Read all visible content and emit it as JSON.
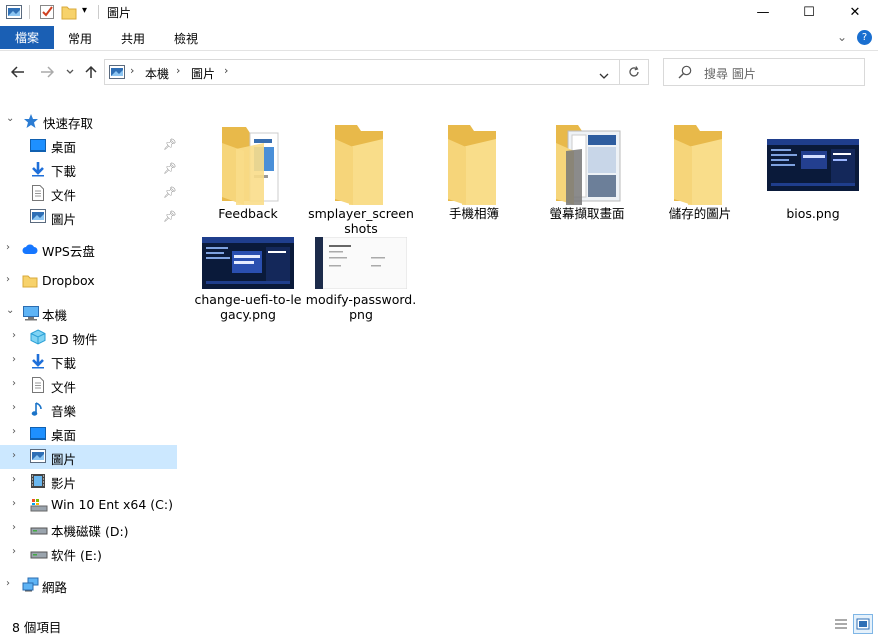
{
  "window": {
    "title": "圖片",
    "minimize_glyph": "—",
    "maximize_glyph": "☐",
    "close_glyph": "✕"
  },
  "ribbon": {
    "file_tab": "檔案",
    "tabs": [
      "常用",
      "共用",
      "檢視"
    ]
  },
  "address": {
    "segments": [
      "本機",
      "圖片"
    ],
    "search_placeholder": "搜尋 圖片"
  },
  "sidebar": {
    "quick_access": "快速存取",
    "quick_items": [
      {
        "label": "桌面",
        "icon": "desktop-icon"
      },
      {
        "label": "下載",
        "icon": "download-icon"
      },
      {
        "label": "文件",
        "icon": "document-icon"
      },
      {
        "label": "圖片",
        "icon": "pictures-icon"
      }
    ],
    "wps": "WPS云盘",
    "dropbox": "Dropbox",
    "this_pc": "本機",
    "pc_items": [
      {
        "label": "3D 物件",
        "icon": "3d-objects-icon"
      },
      {
        "label": "下載",
        "icon": "download-icon"
      },
      {
        "label": "文件",
        "icon": "document-icon"
      },
      {
        "label": "音樂",
        "icon": "music-icon"
      },
      {
        "label": "桌面",
        "icon": "desktop-icon"
      },
      {
        "label": "圖片",
        "icon": "pictures-icon"
      },
      {
        "label": "影片",
        "icon": "video-icon"
      },
      {
        "label": "Win 10 Ent x64 (C:)",
        "icon": "system-drive-icon"
      },
      {
        "label": "本機磁碟 (D:)",
        "icon": "drive-icon"
      },
      {
        "label": "软件 (E:)",
        "icon": "drive-icon"
      }
    ],
    "network": "網路"
  },
  "files": [
    {
      "name": "Feedback",
      "kind": "folder-with-docs"
    },
    {
      "name": "smplayer_screenshots",
      "kind": "folder"
    },
    {
      "name": "手機相簿",
      "kind": "folder"
    },
    {
      "name": "螢幕擷取畫面",
      "kind": "folder-with-screens"
    },
    {
      "name": "儲存的圖片",
      "kind": "folder"
    },
    {
      "name": "bios.png",
      "kind": "bios-image"
    },
    {
      "name": "change-uefi-to-legacy.png",
      "kind": "bios-image"
    },
    {
      "name": "modify-password.png",
      "kind": "light-image"
    }
  ],
  "status": {
    "count": "8 個項目"
  }
}
